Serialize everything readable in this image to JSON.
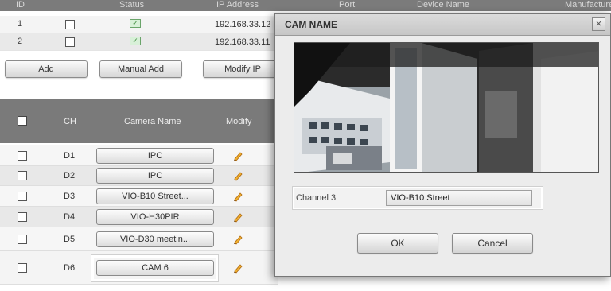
{
  "device_table": {
    "headers": [
      "ID",
      "",
      "Status",
      "IP Address",
      "Port",
      "Device Name",
      "Manufacturer"
    ],
    "rows": [
      {
        "num": "1",
        "ip": "192.168.33.12"
      },
      {
        "num": "2",
        "ip": "192.168.33.11"
      }
    ]
  },
  "toolbar": {
    "add_label": "Add",
    "manual_add_label": "Manual Add",
    "modify_ip_label": "Modify IP"
  },
  "camera_table": {
    "headers": {
      "ch": "CH",
      "camera_name": "Camera Name",
      "modify": "Modify"
    },
    "rows": [
      {
        "ch": "D1",
        "name": "IPC"
      },
      {
        "ch": "D2",
        "name": "IPC"
      },
      {
        "ch": "D3",
        "name": "VIO-B10 Street..."
      },
      {
        "ch": "D4",
        "name": "VIO-H30PIR"
      },
      {
        "ch": "D5",
        "name": "VIO-D30 meetin..."
      },
      {
        "ch": "D6",
        "name": "CAM 6"
      }
    ]
  },
  "modal": {
    "title": "CAM NAME",
    "close_glyph": "×",
    "channel_label": "Channel 3",
    "channel_value": "VIO-B10 Street",
    "ok_label": "OK",
    "cancel_label": "Cancel"
  },
  "icons": {
    "status": "status-ok-icon",
    "modify": "pencil-icon",
    "close": "close-icon"
  },
  "colors": {
    "header_bg": "#7a7a7a",
    "status_green": "#3c8a3c",
    "pencil_orange": "#e09a1a"
  }
}
